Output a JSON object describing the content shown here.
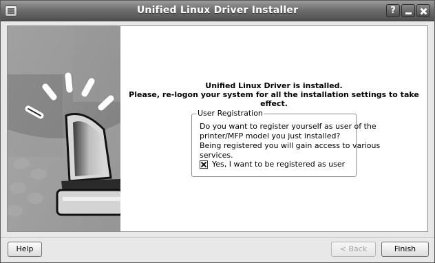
{
  "window": {
    "title": "Unified Linux Driver Installer",
    "help_button": "?"
  },
  "message": {
    "line1": "Unified Linux Driver is installed.",
    "line2": "Please, re-logon your system for all the installation settings to take effect."
  },
  "registration": {
    "legend": "User Registration",
    "lines": [
      "Do you want to register yourself as user of the",
      "printer/MFP model you just installed?",
      "Being registered you will gain access to various",
      "services."
    ],
    "checkbox_label": "Yes, I want to be registered as user",
    "checked": true
  },
  "footer": {
    "help": "Help",
    "back": "< Back",
    "finish": "Finish"
  }
}
